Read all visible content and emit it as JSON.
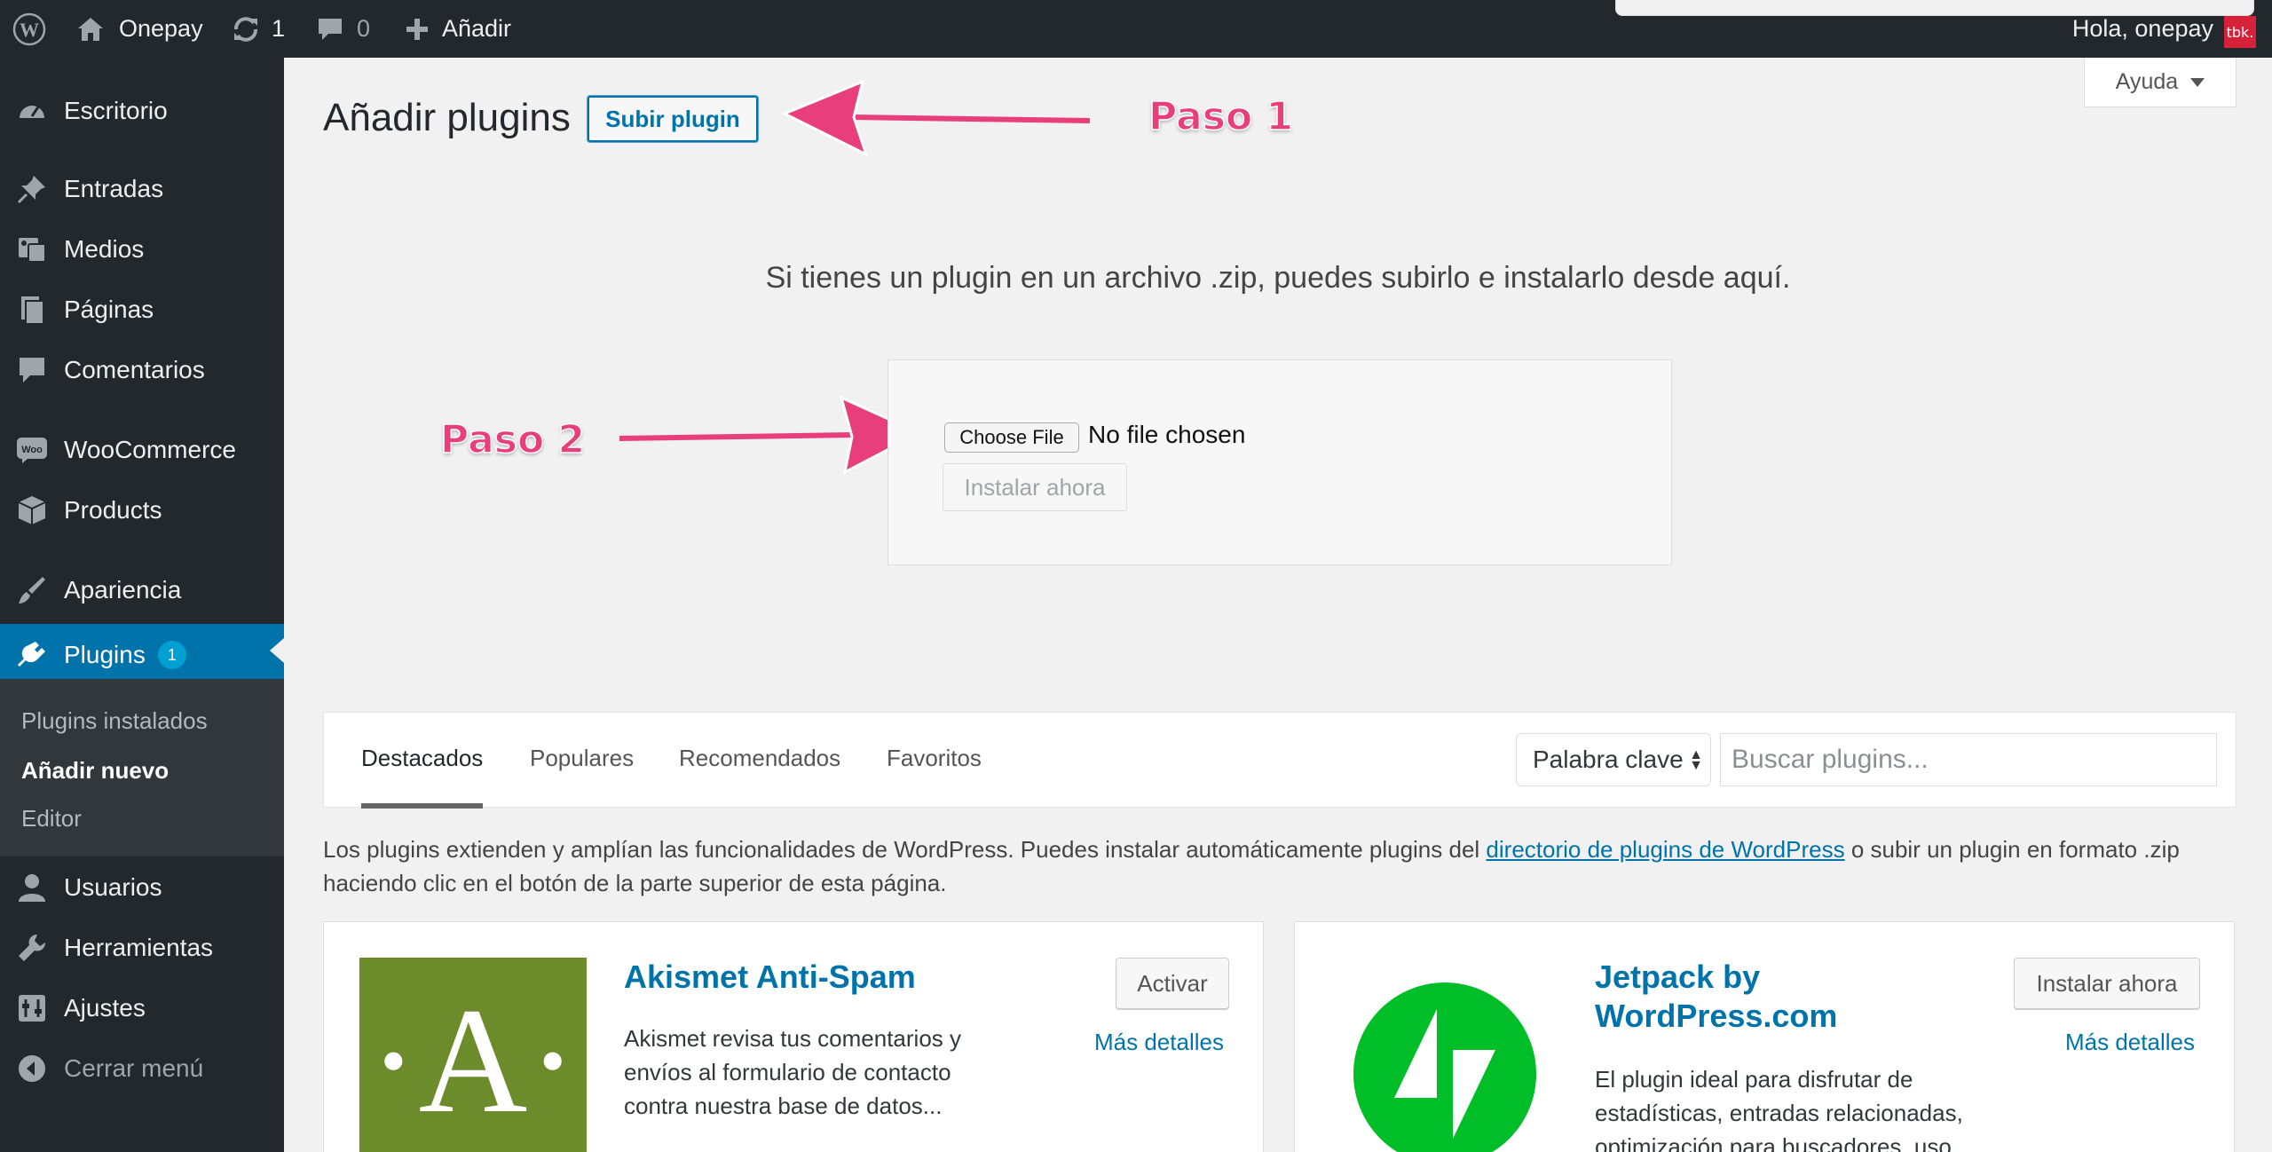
{
  "adminbar": {
    "site_name": "Onepay",
    "updates_count": "1",
    "comments_count": "0",
    "add_new": "Añadir",
    "greeting": "Hola, onepay",
    "avatar_text": "tbk."
  },
  "sidebar": {
    "items": [
      {
        "label": "Escritorio",
        "icon": "dashboard-icon"
      },
      {
        "label": "Entradas",
        "icon": "pin-icon"
      },
      {
        "label": "Medios",
        "icon": "media-icon"
      },
      {
        "label": "Páginas",
        "icon": "pages-icon"
      },
      {
        "label": "Comentarios",
        "icon": "comment-icon"
      },
      {
        "label": "WooCommerce",
        "icon": "woo-icon"
      },
      {
        "label": "Products",
        "icon": "box-icon"
      },
      {
        "label": "Apariencia",
        "icon": "brush-icon"
      },
      {
        "label": "Plugins",
        "icon": "plugin-icon",
        "badge": "1"
      },
      {
        "label": "Usuarios",
        "icon": "user-icon"
      },
      {
        "label": "Herramientas",
        "icon": "wrench-icon"
      },
      {
        "label": "Ajustes",
        "icon": "settings-icon"
      },
      {
        "label": "Cerrar menú",
        "icon": "collapse-icon"
      }
    ],
    "submenu": [
      "Plugins instalados",
      "Añadir nuevo",
      "Editor"
    ]
  },
  "header": {
    "title": "Añadir plugins",
    "upload_button": "Subir plugin",
    "help": "Ayuda"
  },
  "annotations": {
    "step1": "Paso 1",
    "step2": "Paso 2"
  },
  "upload": {
    "description": "Si tienes un plugin en un archivo .zip, puedes subirlo e instalarlo desde aquí.",
    "choose_file": "Choose File",
    "no_file": "No file chosen",
    "install_now": "Instalar ahora"
  },
  "filter": {
    "tabs": [
      "Destacados",
      "Populares",
      "Recomendados",
      "Favoritos"
    ],
    "search_type": "Palabra clave",
    "search_placeholder": "Buscar plugins..."
  },
  "intro": {
    "before": "Los plugins extienden y amplían las funcionalidades de WordPress. Puedes instalar automáticamente plugins del ",
    "link": "directorio de plugins de WordPress",
    "after": " o subir un plugin en formato .zip haciendo clic en el botón de la parte superior de esta página."
  },
  "plugins": [
    {
      "name": "Akismet Anti-Spam",
      "description": "Akismet revisa tus comentarios y envíos al formulario de contacto contra nuestra base de datos...",
      "action": "Activar",
      "more": "Más detalles",
      "icon_letter": "·A·",
      "icon_color": "#6c8c2b"
    },
    {
      "name": "Jetpack by WordPress.com",
      "description": "El plugin ideal para disfrutar de estadísticas, entradas relacionadas, optimización para buscadores, uso...",
      "action": "Instalar ahora",
      "more": "Más detalles",
      "icon_color": "#00be28"
    }
  ],
  "colors": {
    "accent": "#0073aa",
    "annotation": "#e83f7b",
    "sidebar": "#23282d"
  }
}
